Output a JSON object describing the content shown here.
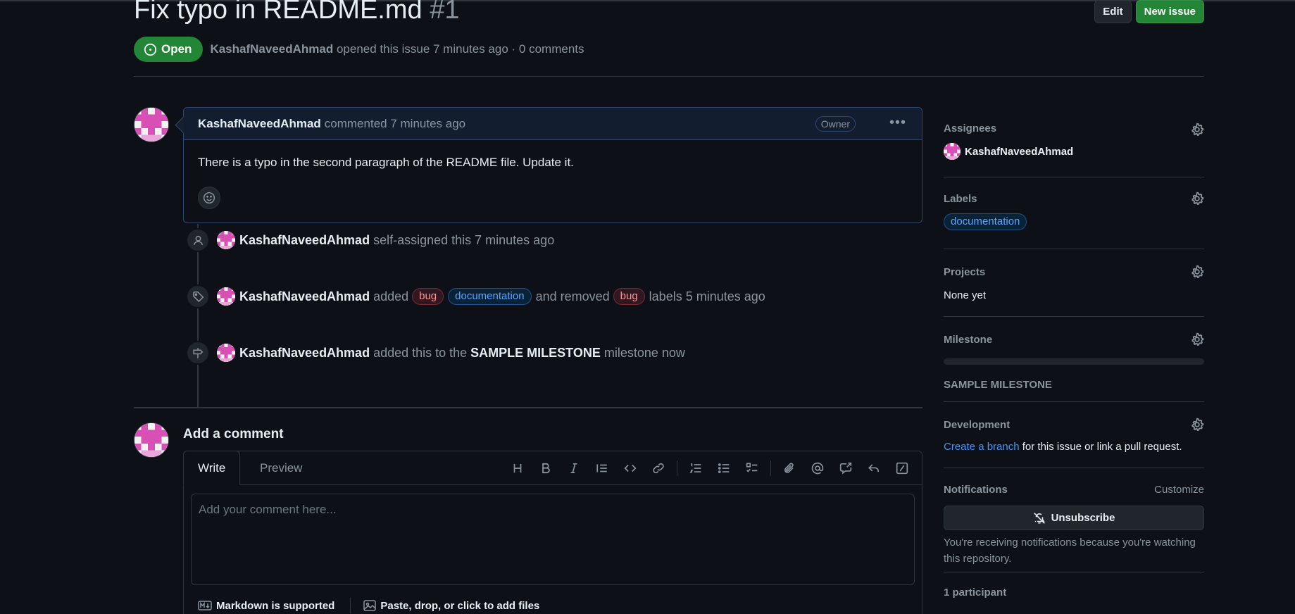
{
  "issue": {
    "title": "Fix typo in README.md",
    "number": "#1",
    "state": "Open",
    "author": "KashafNaveedAhmad",
    "meta_text": "opened this issue 7 minutes ago · 0 comments"
  },
  "header_actions": {
    "edit_label": "Edit",
    "new_issue_label": "New issue"
  },
  "comment": {
    "author": "KashafNaveedAhmad",
    "action": "commented 7 minutes ago",
    "badge": "Owner",
    "body": "There is a typo in the second paragraph of the README file. Update it."
  },
  "timeline": [
    {
      "icon": "person-icon",
      "author": "KashafNaveedAhmad",
      "text": "self-assigned this 7 minutes ago"
    },
    {
      "icon": "tag-icon",
      "author": "KashafNaveedAhmad",
      "added": "added",
      "labels_added": [
        "bug",
        "documentation"
      ],
      "removed": "and removed",
      "labels_removed": [
        "bug"
      ],
      "suffix": "labels 5 minutes ago"
    },
    {
      "icon": "milestone-icon",
      "author": "KashafNaveedAhmad",
      "text_before": "added this to the",
      "milestone": "SAMPLE MILESTONE",
      "text_after": "milestone now"
    }
  ],
  "add_comment": {
    "title": "Add a comment",
    "tab_write": "Write",
    "tab_preview": "Preview",
    "placeholder": "Add your comment here...",
    "markdown_note": "Markdown is supported",
    "files_note": "Paste, drop, or click to add files",
    "toolbar": [
      "heading-icon",
      "bold-icon",
      "italic-icon",
      "quote-icon",
      "code-icon",
      "link-icon",
      "ordered-list-icon",
      "unordered-list-icon",
      "task-list-icon",
      "attach-icon",
      "mention-icon",
      "reference-icon",
      "reply-icon",
      "slash-command-icon"
    ]
  },
  "sidebar": {
    "assignees": {
      "heading": "Assignees",
      "name": "KashafNaveedAhmad"
    },
    "labels": {
      "heading": "Labels",
      "label": "documentation"
    },
    "projects": {
      "heading": "Projects",
      "value": "None yet"
    },
    "milestone": {
      "heading": "Milestone",
      "name": "SAMPLE MILESTONE",
      "progress": 0
    },
    "development": {
      "heading": "Development",
      "link": "Create a branch",
      "text": "for this issue or link a pull request."
    },
    "notifications": {
      "heading": "Notifications",
      "customize": "Customize",
      "button": "Unsubscribe",
      "note": "You're receiving notifications because you're watching this repository."
    },
    "participants": {
      "heading": "1 participant"
    }
  },
  "colors": {
    "open_green": "#238636",
    "link_blue": "#4493f8",
    "bug_red": "#ff9492",
    "doc_blue": "#58a6ff",
    "background": "#0d1117"
  }
}
